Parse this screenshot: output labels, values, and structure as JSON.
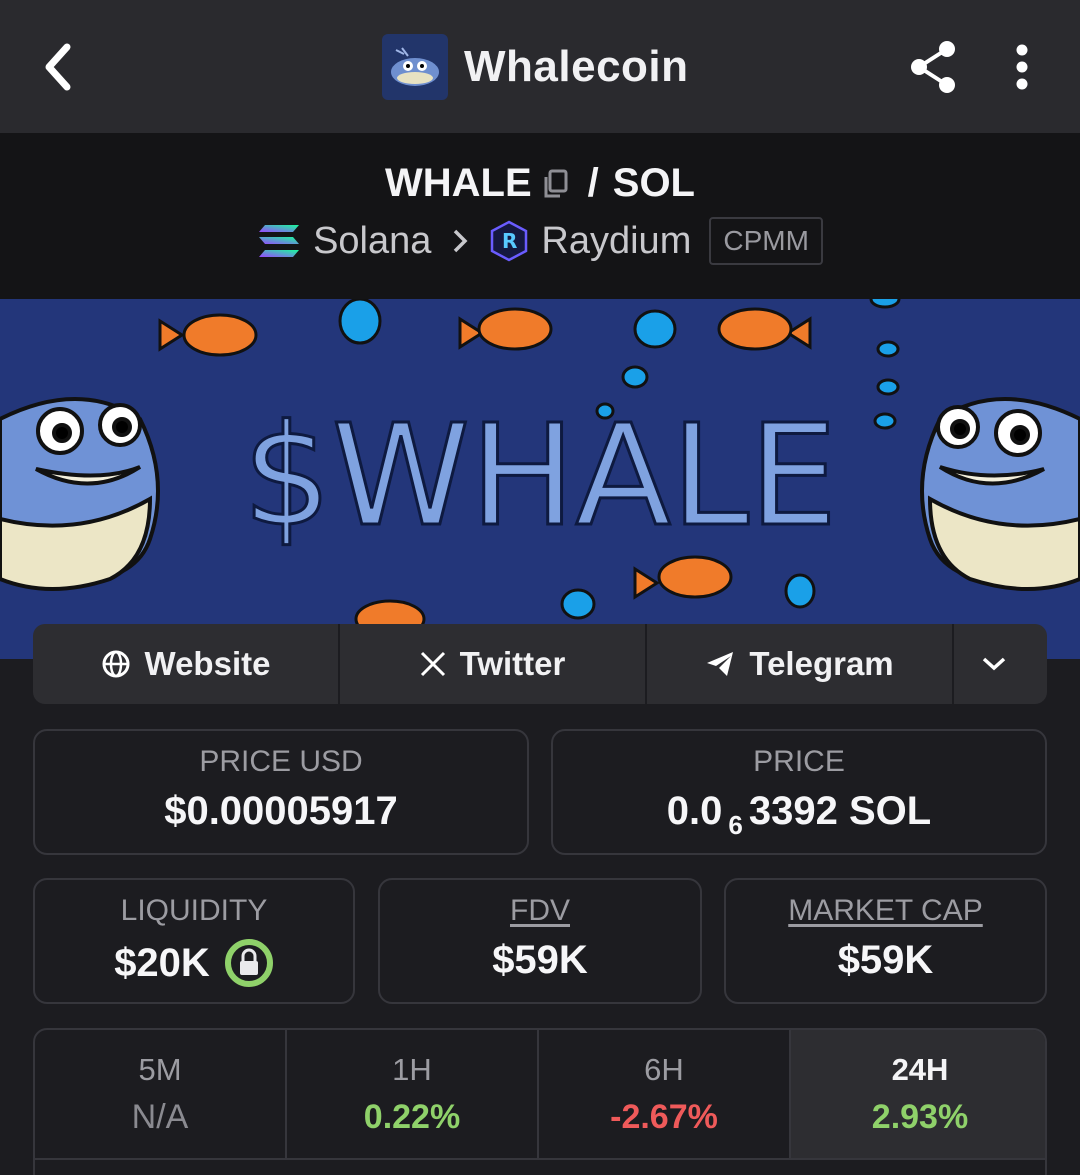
{
  "header": {
    "title": "Whalecoin"
  },
  "pair": {
    "base": "WHALE",
    "separator": "/",
    "quote": "SOL",
    "chain": "Solana",
    "dex": "Raydium",
    "pool_type": "CPMM"
  },
  "banner": {
    "text": "$WHALE"
  },
  "links": {
    "website": "Website",
    "twitter": "Twitter",
    "telegram": "Telegram"
  },
  "stats": {
    "price_usd_label": "PRICE USD",
    "price_usd": "$0.00005917",
    "price_label": "PRICE",
    "price_prefix": "0.0",
    "price_zeros": "6",
    "price_digits": "3392 SOL",
    "liquidity_label": "LIQUIDITY",
    "liquidity": "$20K",
    "fdv_label": "FDV",
    "fdv": "$59K",
    "mcap_label": "MARKET CAP",
    "mcap": "$59K"
  },
  "timeframes": [
    {
      "label": "5M",
      "value": "N/A"
    },
    {
      "label": "1H",
      "value": "0.22%"
    },
    {
      "label": "6H",
      "value": "-2.67%"
    },
    {
      "label": "24H",
      "value": "2.93%"
    }
  ],
  "colors": {
    "positive": "#8fd16a",
    "negative": "#ef5a5a",
    "lock": "#8fd16a"
  }
}
